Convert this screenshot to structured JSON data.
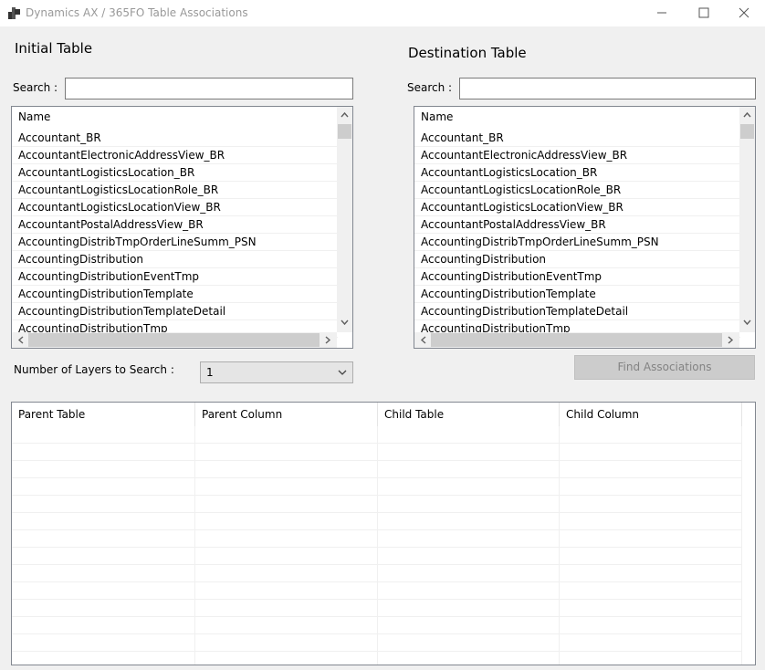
{
  "window": {
    "title": "Dynamics AX / 365FO Table Associations"
  },
  "initial": {
    "heading": "Initial Table",
    "search_label": "Search :",
    "search_value": "",
    "column_header": "Name",
    "items": [
      "Accountant_BR",
      "AccountantElectronicAddressView_BR",
      "AccountantLogisticsLocation_BR",
      "AccountantLogisticsLocationRole_BR",
      "AccountantLogisticsLocationView_BR",
      "AccountantPostalAddressView_BR",
      "AccountingDistribTmpOrderLineSumm_PSN",
      "AccountingDistribution",
      "AccountingDistributionEventTmp",
      "AccountingDistributionTemplate",
      "AccountingDistributionTemplateDetail",
      "AccountingDistributionTmp"
    ]
  },
  "destination": {
    "heading": "Destination Table",
    "search_label": "Search :",
    "search_value": "",
    "column_header": "Name",
    "items": [
      "Accountant_BR",
      "AccountantElectronicAddressView_BR",
      "AccountantLogisticsLocation_BR",
      "AccountantLogisticsLocationRole_BR",
      "AccountantLogisticsLocationView_BR",
      "AccountantPostalAddressView_BR",
      "AccountingDistribTmpOrderLineSumm_PSN",
      "AccountingDistribution",
      "AccountingDistributionEventTmp",
      "AccountingDistributionTemplate",
      "AccountingDistributionTemplateDetail",
      "AccountingDistributionTmp"
    ]
  },
  "layers": {
    "label": "Number of Layers to Search :",
    "selected": "1"
  },
  "find_button": {
    "label": "Find Associations"
  },
  "results": {
    "columns": [
      "Parent Table",
      "Parent Column",
      "Child Table",
      "Child Column"
    ]
  },
  "icons": {
    "app": "app-icon",
    "minimize": "minimize-icon",
    "maximize": "maximize-icon",
    "close": "close-icon"
  }
}
